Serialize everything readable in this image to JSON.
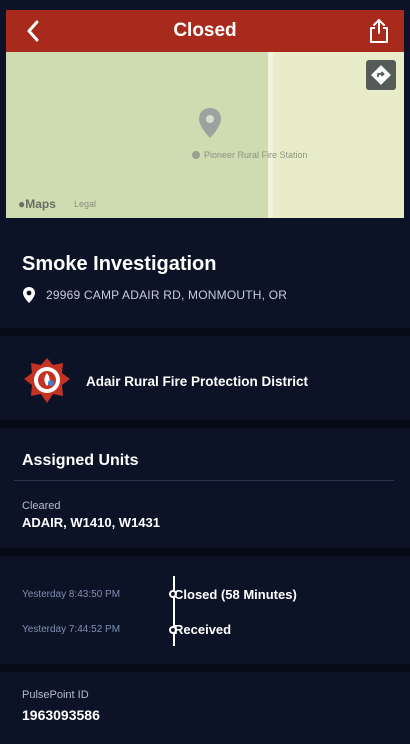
{
  "header": {
    "title": "Closed",
    "back_icon": "chevron-left-icon",
    "share_icon": "share-icon",
    "background": "#a82a1d"
  },
  "map": {
    "attribution": "Maps",
    "legal": "Legal",
    "poi_label": "Pioneer Rural Fire Station",
    "directions_icon": "directions-icon"
  },
  "incident": {
    "title": "Smoke Investigation",
    "address": "29969 CAMP ADAIR RD, MONMOUTH, OR",
    "address_icon": "location-pin-icon"
  },
  "agency": {
    "name": "Adair Rural Fire Protection District",
    "logo_icon": "fire-district-badge-icon"
  },
  "units": {
    "title": "Assigned Units",
    "status_label": "Cleared",
    "list": "ADAIR, W1410, W1431"
  },
  "timeline": [
    {
      "time": "Yesterday 8:43:50 PM",
      "status": "Closed (58 Minutes)"
    },
    {
      "time": "Yesterday 7:44:52 PM",
      "status": "Received"
    }
  ],
  "pulsepoint": {
    "label": "PulsePoint ID",
    "id": "1963093586"
  }
}
